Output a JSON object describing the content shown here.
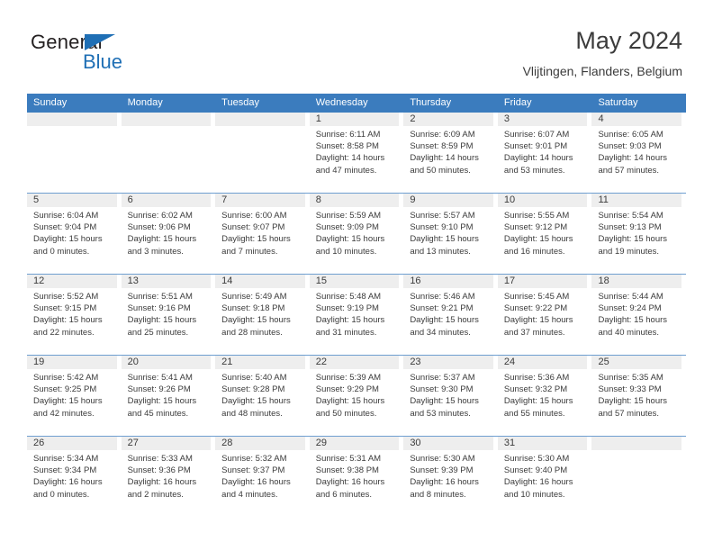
{
  "logo": {
    "word_one": "General",
    "word_two": "Blue",
    "triangle_color": "#1f6fb5",
    "icon": "triangle-icon"
  },
  "header": {
    "title": "May 2024",
    "location": "Vlijtingen, Flanders, Belgium"
  },
  "theme": {
    "header_blue": "#3b7cbe",
    "daynum_gray": "#eeeeee",
    "text": "#3b3b3b"
  },
  "calendar": {
    "weekday_headers": [
      "Sunday",
      "Monday",
      "Tuesday",
      "Wednesday",
      "Thursday",
      "Friday",
      "Saturday"
    ],
    "weeks": [
      [
        {
          "day": "",
          "blank": true,
          "sunrise": "",
          "sunset": "",
          "daylight_1": "",
          "daylight_2": ""
        },
        {
          "day": "",
          "blank": true,
          "sunrise": "",
          "sunset": "",
          "daylight_1": "",
          "daylight_2": ""
        },
        {
          "day": "",
          "blank": true,
          "sunrise": "",
          "sunset": "",
          "daylight_1": "",
          "daylight_2": ""
        },
        {
          "day": "1",
          "sunrise": "Sunrise: 6:11 AM",
          "sunset": "Sunset: 8:58 PM",
          "daylight_1": "Daylight: 14 hours",
          "daylight_2": "and 47 minutes."
        },
        {
          "day": "2",
          "sunrise": "Sunrise: 6:09 AM",
          "sunset": "Sunset: 8:59 PM",
          "daylight_1": "Daylight: 14 hours",
          "daylight_2": "and 50 minutes."
        },
        {
          "day": "3",
          "sunrise": "Sunrise: 6:07 AM",
          "sunset": "Sunset: 9:01 PM",
          "daylight_1": "Daylight: 14 hours",
          "daylight_2": "and 53 minutes."
        },
        {
          "day": "4",
          "sunrise": "Sunrise: 6:05 AM",
          "sunset": "Sunset: 9:03 PM",
          "daylight_1": "Daylight: 14 hours",
          "daylight_2": "and 57 minutes."
        }
      ],
      [
        {
          "day": "5",
          "sunrise": "Sunrise: 6:04 AM",
          "sunset": "Sunset: 9:04 PM",
          "daylight_1": "Daylight: 15 hours",
          "daylight_2": "and 0 minutes."
        },
        {
          "day": "6",
          "sunrise": "Sunrise: 6:02 AM",
          "sunset": "Sunset: 9:06 PM",
          "daylight_1": "Daylight: 15 hours",
          "daylight_2": "and 3 minutes."
        },
        {
          "day": "7",
          "sunrise": "Sunrise: 6:00 AM",
          "sunset": "Sunset: 9:07 PM",
          "daylight_1": "Daylight: 15 hours",
          "daylight_2": "and 7 minutes."
        },
        {
          "day": "8",
          "sunrise": "Sunrise: 5:59 AM",
          "sunset": "Sunset: 9:09 PM",
          "daylight_1": "Daylight: 15 hours",
          "daylight_2": "and 10 minutes."
        },
        {
          "day": "9",
          "sunrise": "Sunrise: 5:57 AM",
          "sunset": "Sunset: 9:10 PM",
          "daylight_1": "Daylight: 15 hours",
          "daylight_2": "and 13 minutes."
        },
        {
          "day": "10",
          "sunrise": "Sunrise: 5:55 AM",
          "sunset": "Sunset: 9:12 PM",
          "daylight_1": "Daylight: 15 hours",
          "daylight_2": "and 16 minutes."
        },
        {
          "day": "11",
          "sunrise": "Sunrise: 5:54 AM",
          "sunset": "Sunset: 9:13 PM",
          "daylight_1": "Daylight: 15 hours",
          "daylight_2": "and 19 minutes."
        }
      ],
      [
        {
          "day": "12",
          "sunrise": "Sunrise: 5:52 AM",
          "sunset": "Sunset: 9:15 PM",
          "daylight_1": "Daylight: 15 hours",
          "daylight_2": "and 22 minutes."
        },
        {
          "day": "13",
          "sunrise": "Sunrise: 5:51 AM",
          "sunset": "Sunset: 9:16 PM",
          "daylight_1": "Daylight: 15 hours",
          "daylight_2": "and 25 minutes."
        },
        {
          "day": "14",
          "sunrise": "Sunrise: 5:49 AM",
          "sunset": "Sunset: 9:18 PM",
          "daylight_1": "Daylight: 15 hours",
          "daylight_2": "and 28 minutes."
        },
        {
          "day": "15",
          "sunrise": "Sunrise: 5:48 AM",
          "sunset": "Sunset: 9:19 PM",
          "daylight_1": "Daylight: 15 hours",
          "daylight_2": "and 31 minutes."
        },
        {
          "day": "16",
          "sunrise": "Sunrise: 5:46 AM",
          "sunset": "Sunset: 9:21 PM",
          "daylight_1": "Daylight: 15 hours",
          "daylight_2": "and 34 minutes."
        },
        {
          "day": "17",
          "sunrise": "Sunrise: 5:45 AM",
          "sunset": "Sunset: 9:22 PM",
          "daylight_1": "Daylight: 15 hours",
          "daylight_2": "and 37 minutes."
        },
        {
          "day": "18",
          "sunrise": "Sunrise: 5:44 AM",
          "sunset": "Sunset: 9:24 PM",
          "daylight_1": "Daylight: 15 hours",
          "daylight_2": "and 40 minutes."
        }
      ],
      [
        {
          "day": "19",
          "sunrise": "Sunrise: 5:42 AM",
          "sunset": "Sunset: 9:25 PM",
          "daylight_1": "Daylight: 15 hours",
          "daylight_2": "and 42 minutes."
        },
        {
          "day": "20",
          "sunrise": "Sunrise: 5:41 AM",
          "sunset": "Sunset: 9:26 PM",
          "daylight_1": "Daylight: 15 hours",
          "daylight_2": "and 45 minutes."
        },
        {
          "day": "21",
          "sunrise": "Sunrise: 5:40 AM",
          "sunset": "Sunset: 9:28 PM",
          "daylight_1": "Daylight: 15 hours",
          "daylight_2": "and 48 minutes."
        },
        {
          "day": "22",
          "sunrise": "Sunrise: 5:39 AM",
          "sunset": "Sunset: 9:29 PM",
          "daylight_1": "Daylight: 15 hours",
          "daylight_2": "and 50 minutes."
        },
        {
          "day": "23",
          "sunrise": "Sunrise: 5:37 AM",
          "sunset": "Sunset: 9:30 PM",
          "daylight_1": "Daylight: 15 hours",
          "daylight_2": "and 53 minutes."
        },
        {
          "day": "24",
          "sunrise": "Sunrise: 5:36 AM",
          "sunset": "Sunset: 9:32 PM",
          "daylight_1": "Daylight: 15 hours",
          "daylight_2": "and 55 minutes."
        },
        {
          "day": "25",
          "sunrise": "Sunrise: 5:35 AM",
          "sunset": "Sunset: 9:33 PM",
          "daylight_1": "Daylight: 15 hours",
          "daylight_2": "and 57 minutes."
        }
      ],
      [
        {
          "day": "26",
          "sunrise": "Sunrise: 5:34 AM",
          "sunset": "Sunset: 9:34 PM",
          "daylight_1": "Daylight: 16 hours",
          "daylight_2": "and 0 minutes."
        },
        {
          "day": "27",
          "sunrise": "Sunrise: 5:33 AM",
          "sunset": "Sunset: 9:36 PM",
          "daylight_1": "Daylight: 16 hours",
          "daylight_2": "and 2 minutes."
        },
        {
          "day": "28",
          "sunrise": "Sunrise: 5:32 AM",
          "sunset": "Sunset: 9:37 PM",
          "daylight_1": "Daylight: 16 hours",
          "daylight_2": "and 4 minutes."
        },
        {
          "day": "29",
          "sunrise": "Sunrise: 5:31 AM",
          "sunset": "Sunset: 9:38 PM",
          "daylight_1": "Daylight: 16 hours",
          "daylight_2": "and 6 minutes."
        },
        {
          "day": "30",
          "sunrise": "Sunrise: 5:30 AM",
          "sunset": "Sunset: 9:39 PM",
          "daylight_1": "Daylight: 16 hours",
          "daylight_2": "and 8 minutes."
        },
        {
          "day": "31",
          "sunrise": "Sunrise: 5:30 AM",
          "sunset": "Sunset: 9:40 PM",
          "daylight_1": "Daylight: 16 hours",
          "daylight_2": "and 10 minutes."
        },
        {
          "day": "",
          "blank": true,
          "sunrise": "",
          "sunset": "",
          "daylight_1": "",
          "daylight_2": ""
        }
      ]
    ]
  }
}
